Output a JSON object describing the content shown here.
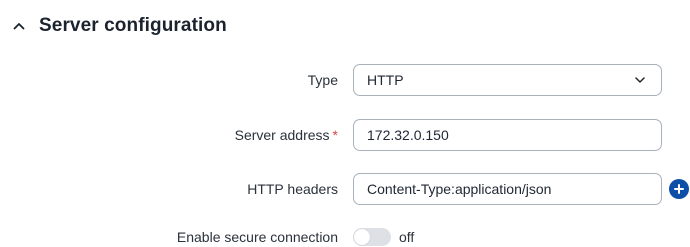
{
  "section": {
    "title": "Server configuration",
    "collapse_icon": "chevron-up-icon"
  },
  "form": {
    "type": {
      "label": "Type",
      "value": "HTTP",
      "icon": "chevron-down-icon"
    },
    "server_address": {
      "label": "Server address",
      "required_mark": "*",
      "value": "172.32.0.150"
    },
    "http_headers": {
      "label": "HTTP headers",
      "value": "Content-Type:application/json",
      "add_icon": "plus-circle-icon"
    },
    "secure_connection": {
      "label": "Enable secure connection",
      "enabled": false,
      "state_text": "off"
    }
  },
  "colors": {
    "required": "#d64545",
    "accent": "#0d4fa6",
    "toggle_off": "#dde1e6",
    "border": "#a9b1bb"
  }
}
